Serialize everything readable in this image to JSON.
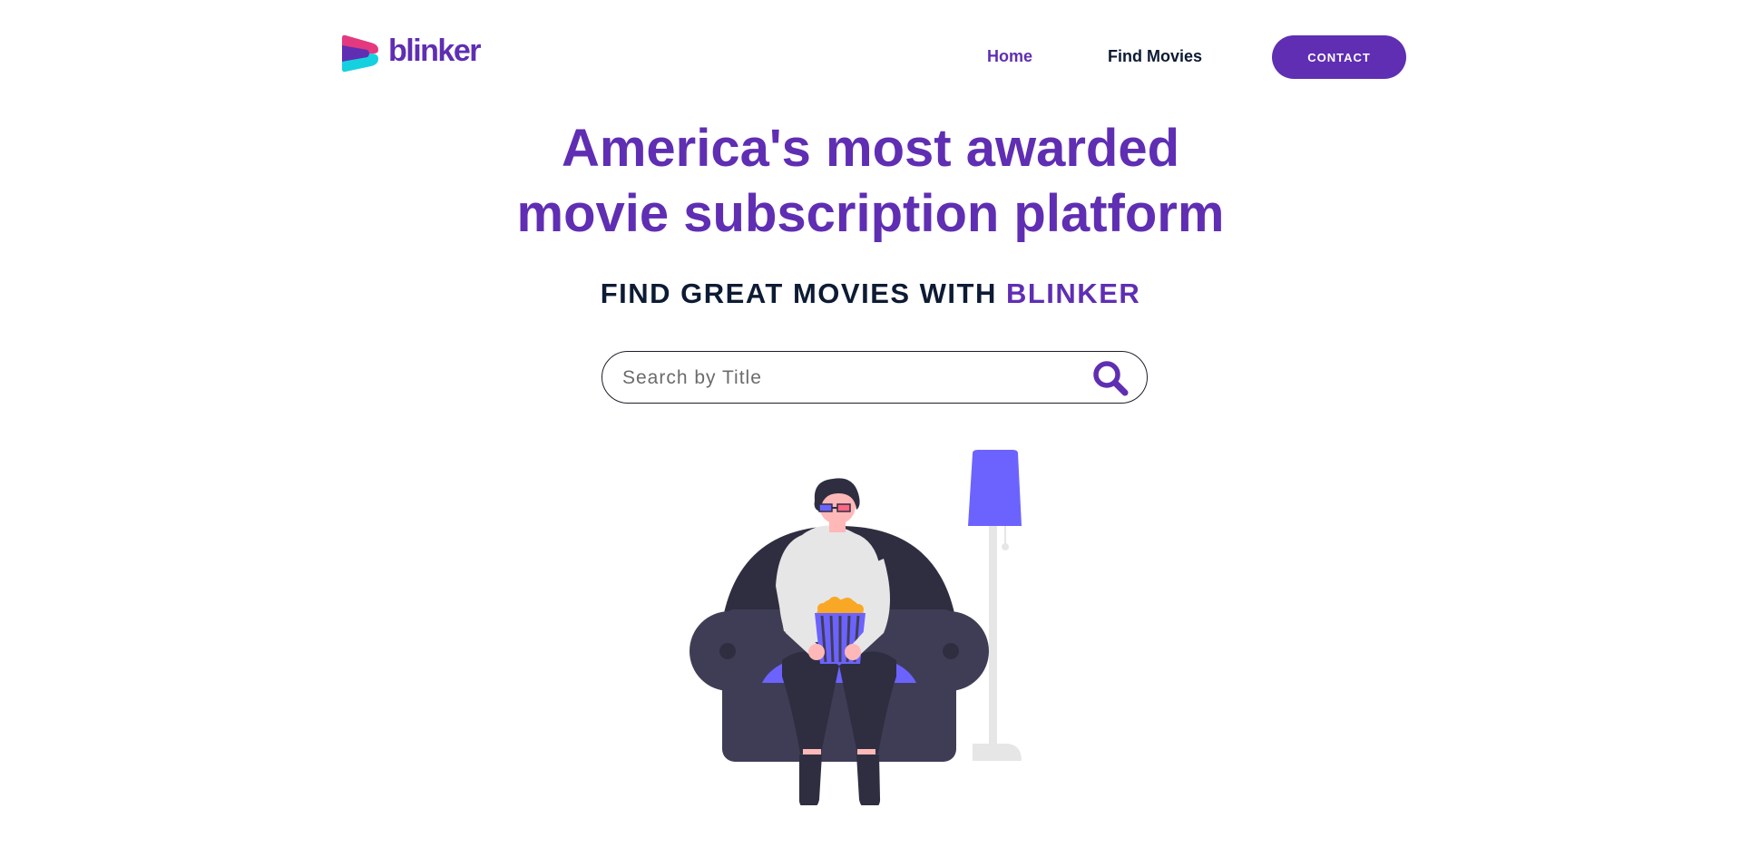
{
  "brand": {
    "name": "blinker",
    "colors": {
      "primary": "#5f2eb3",
      "dark": "#0d1b34",
      "logo_pink": "#e4397f",
      "logo_cyan": "#15d1e0",
      "accent_blue": "#6c63ff"
    }
  },
  "nav": {
    "home_label": "Home",
    "find_movies_label": "Find Movies",
    "contact_label": "CONTACT"
  },
  "hero": {
    "title_line1": "America's most awarded",
    "title_line2": "movie subscription platform",
    "subtitle_prefix": "FIND GREAT MOVIES WITH ",
    "subtitle_accent": "BLINKER"
  },
  "search": {
    "placeholder": "Search by Title",
    "value": "",
    "icon": "search-icon"
  },
  "illustration": {
    "icon": "person-on-sofa-with-popcorn-illustration"
  }
}
